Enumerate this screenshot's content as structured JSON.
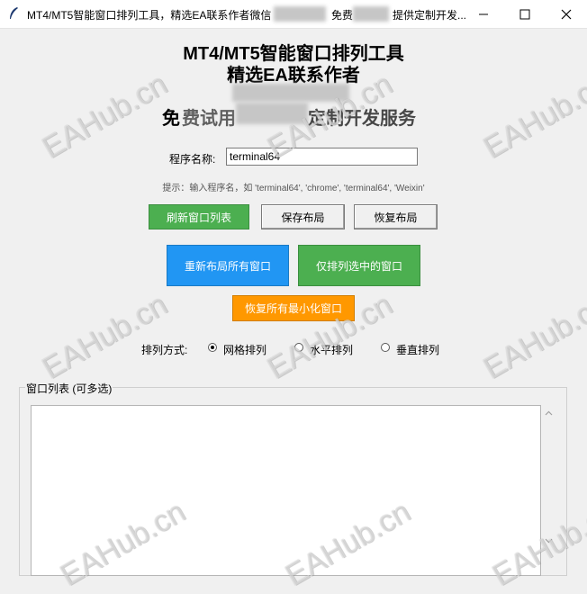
{
  "window": {
    "title": "MT4/MT5智能窗口排列工具，精选EA联系作者微信",
    "title_tail1": "免费",
    "title_tail2": "提供定制开发..."
  },
  "header": {
    "line1": "MT4/MT5智能窗口排列工具",
    "line2": "精选EA联系作者",
    "line4a": "免",
    "line4b": "费试用",
    "line4c": "定制开发服务"
  },
  "form": {
    "program_label": "程序名称:",
    "program_value": "terminal64",
    "hint": "提示：输入程序名，如 'terminal64', 'chrome', 'terminal64', 'Weixin'"
  },
  "buttons": {
    "refresh": "刷新窗口列表",
    "save": "保存布局",
    "restore": "恢复布局",
    "relayout_all": "重新布局所有窗口",
    "arrange_selected": "仅排列选中的窗口",
    "restore_minimized": "恢复所有最小化窗口"
  },
  "arrange": {
    "label": "排列方式:",
    "options": [
      "网格排列",
      "水平排列",
      "垂直排列"
    ],
    "selected": "网格排列"
  },
  "window_list": {
    "title": "窗口列表 (可多选)"
  },
  "watermark": "EAHub.cn",
  "colors": {
    "green": "#4caf50",
    "blue": "#2196f3",
    "orange": "#ff9800"
  }
}
